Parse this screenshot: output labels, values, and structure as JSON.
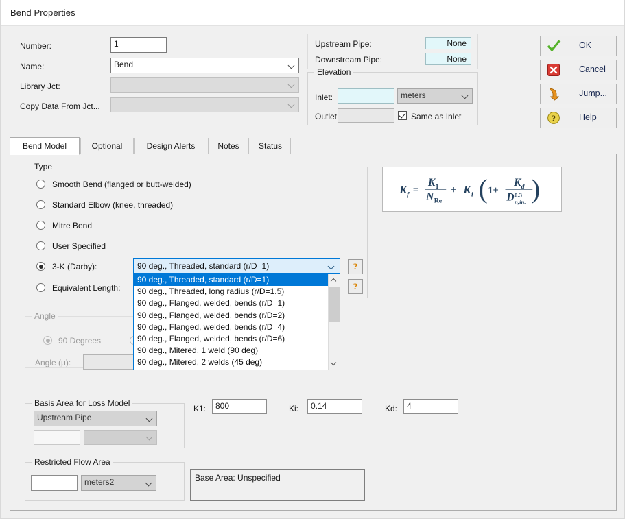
{
  "window": {
    "title": "Bend Properties"
  },
  "header": {
    "fields": [
      {
        "label": "Number:",
        "value": "1",
        "type": "text"
      },
      {
        "label": "Name:",
        "value": "Bend",
        "type": "combo"
      },
      {
        "label": "Library Jct:",
        "value": "",
        "type": "combo-disabled"
      },
      {
        "label": "Copy Data From Jct...",
        "value": "",
        "type": "combo-disabled"
      }
    ],
    "pipes": [
      {
        "label": "Upstream Pipe:",
        "value": "None"
      },
      {
        "label": "Downstream Pipe:",
        "value": "None"
      }
    ],
    "elevation": {
      "title": "Elevation",
      "inlet_label": "Inlet:",
      "inlet_value": "",
      "units": "meters",
      "outlet_label": "Outlet:",
      "outlet_value": "",
      "same_as_inlet_label": "Same as Inlet",
      "same_as_inlet_checked": true
    },
    "buttons": [
      {
        "label": "OK",
        "icon": "green-check-icon"
      },
      {
        "label": "Cancel",
        "icon": "red-x-icon"
      },
      {
        "label": "Jump...",
        "icon": "orange-arrow-icon"
      },
      {
        "label": "Help",
        "icon": "yellow-question-icon"
      }
    ]
  },
  "tabs": [
    {
      "label": "Bend Model",
      "selected": true
    },
    {
      "label": "Optional",
      "selected": false
    },
    {
      "label": "Design Alerts",
      "selected": false
    },
    {
      "label": "Notes",
      "selected": false
    },
    {
      "label": "Status",
      "selected": false
    }
  ],
  "bend_model": {
    "type_group": {
      "title": "Type",
      "options": [
        {
          "label": "Smooth Bend (flanged or butt-welded)",
          "selected": false
        },
        {
          "label": "Standard Elbow (knee, threaded)",
          "selected": false
        },
        {
          "label": "Mitre Bend",
          "selected": false
        },
        {
          "label": "User Specified",
          "selected": false
        },
        {
          "label": "3-K (Darby):",
          "selected": true
        },
        {
          "label": "Equivalent Length:",
          "selected": false
        }
      ],
      "help_buttons": [
        "?",
        "?"
      ]
    },
    "dropdown": {
      "selected_value": "90 deg., Threaded, standard (r/D=1)",
      "open": true,
      "items": [
        "90 deg., Threaded, standard (r/D=1)",
        "90 deg., Threaded, long radius (r/D=1.5)",
        "90 deg., Flanged, welded, bends (r/D=1)",
        "90 deg., Flanged, welded, bends (r/D=2)",
        "90 deg., Flanged, welded, bends (r/D=4)",
        "90 deg., Flanged, welded, bends (r/D=6)",
        "90 deg., Mitered, 1 weld (90 deg)",
        "90 deg., Mitered, 2 welds (45 deg)"
      ],
      "selected_index": 0
    },
    "formula": {
      "kf": "K",
      "kf_sub": "f",
      "equals": "=",
      "k1": "K",
      "k1_sub": "1",
      "nre": "N",
      "nre_sub": "Re",
      "plus": "+",
      "ki": "K",
      "ki_sub": "i",
      "one_plus": "1+",
      "kd": "K",
      "kd_sub": "d",
      "d": "D",
      "d_sub": "n,in.",
      "d_sup": "0.3"
    },
    "angle_group": {
      "title": "Angle",
      "disabled": true,
      "option_90": "90 Degrees",
      "option_90_selected": true,
      "angle_label": "Angle (μ):",
      "angle_value": ""
    },
    "basis_area": {
      "title": "Basis Area for Loss Model",
      "selected": "Upstream Pipe",
      "value": "",
      "units": ""
    },
    "k_values": [
      {
        "label": "K1:",
        "value": "800"
      },
      {
        "label": "Ki:",
        "value": "0.14"
      },
      {
        "label": "Kd:",
        "value": "4"
      }
    ],
    "restricted_flow_area": {
      "title": "Restricted Flow Area",
      "value": "",
      "units": "meters2"
    },
    "base_area_note": "Base Area: Unspecified"
  }
}
